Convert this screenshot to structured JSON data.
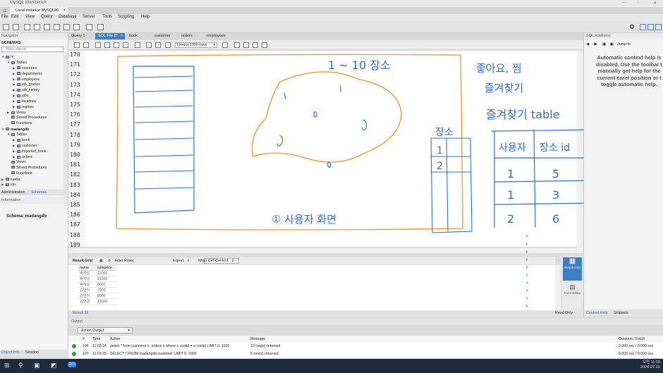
{
  "window": {
    "title": "MySQL Workbench"
  },
  "connection_tab": {
    "label": "Local instance MySQL80"
  },
  "menu": [
    "File",
    "Edit",
    "View",
    "Query",
    "Database",
    "Server",
    "Tools",
    "Scripting",
    "Help"
  ],
  "navigator": {
    "header": "Navigator",
    "schemas_label": "SCHEMAS",
    "filter_placeholder": "Filter objects",
    "tree": [
      {
        "label": "hr",
        "level": 0,
        "arrow": "▼",
        "icon": true
      },
      {
        "label": "Tables",
        "level": 1,
        "arrow": "▼",
        "icon": true
      },
      {
        "label": "countries",
        "level": 2,
        "arrow": "▶",
        "icon": true
      },
      {
        "label": "departments",
        "level": 2,
        "arrow": "▶",
        "icon": true
      },
      {
        "label": "employees",
        "level": 2,
        "arrow": "▶",
        "icon": true
      },
      {
        "label": "job_grades",
        "level": 2,
        "arrow": "▶",
        "icon": true
      },
      {
        "label": "job_history",
        "level": 2,
        "arrow": "▶",
        "icon": true
      },
      {
        "label": "jobs",
        "level": 2,
        "arrow": "▶",
        "icon": true
      },
      {
        "label": "locations",
        "level": 2,
        "arrow": "▶",
        "icon": true
      },
      {
        "label": "regions",
        "level": 2,
        "arrow": "▶",
        "icon": true
      },
      {
        "label": "Views",
        "level": 1,
        "arrow": "▶",
        "icon": true
      },
      {
        "label": "Stored Procedures",
        "level": 1,
        "arrow": "",
        "icon": true
      },
      {
        "label": "Functions",
        "level": 1,
        "arrow": "",
        "icon": true
      },
      {
        "label": "madangdb",
        "level": 0,
        "arrow": "▼",
        "icon": true,
        "bold": true
      },
      {
        "label": "Tables",
        "level": 1,
        "arrow": "▼",
        "icon": true
      },
      {
        "label": "book",
        "level": 2,
        "arrow": "▶",
        "icon": true
      },
      {
        "label": "customer",
        "level": 2,
        "arrow": "▶",
        "icon": true
      },
      {
        "label": "imported_book",
        "level": 2,
        "arrow": "▶",
        "icon": true
      },
      {
        "label": "orders",
        "level": 2,
        "arrow": "▶",
        "icon": true
      },
      {
        "label": "Views",
        "level": 1,
        "arrow": "",
        "icon": true
      },
      {
        "label": "Stored Procedures",
        "level": 1,
        "arrow": "",
        "icon": true
      },
      {
        "label": "Functions",
        "level": 1,
        "arrow": "",
        "icon": true
      },
      {
        "label": "sakila",
        "level": 0,
        "arrow": "▶",
        "icon": true
      },
      {
        "label": "sys",
        "level": 0,
        "arrow": "▶",
        "icon": true
      }
    ],
    "tabs": [
      "Administration",
      "Schemas"
    ],
    "info_header": "Information",
    "schema_info": "Schema: madangdb",
    "bottom_tabs": [
      "Object Info",
      "Session"
    ]
  },
  "query_tabs": [
    "Query 1",
    "SQL File 8*",
    "book",
    "customer",
    "orders",
    "employees"
  ],
  "editor": {
    "limit_label": "Limit to 1000 rows",
    "line_numbers": [
      "170",
      "171",
      "172",
      "173",
      "174",
      "175",
      "176",
      "177",
      "178",
      "179",
      "180",
      "181",
      "182",
      "183",
      "184",
      "185",
      "186",
      "187",
      "188",
      "189"
    ]
  },
  "result_grid": {
    "toolbar": {
      "result_grid": "Result Grid",
      "filter_rows": "Filter Rows:",
      "export": "Export:",
      "wrap": "Wrap Cell Content:"
    },
    "columns": [
      "name",
      "saleprice"
    ],
    "rows": [
      [
        "박지성",
        "12000"
      ],
      [
        "박지성",
        "21000"
      ],
      [
        "박지성",
        "6000"
      ],
      [
        "김연아",
        "7000"
      ],
      [
        "김연아",
        "8000"
      ],
      [
        "김연경",
        "13000"
      ]
    ],
    "side_buttons": [
      "Result Grid",
      "Form Editor"
    ],
    "result_tab": "Result 39",
    "read_only": "Read Only"
  },
  "sql_additions": {
    "header": "SQL Additions",
    "jump_to": "Jump to",
    "help_lines": [
      "Automatic context help is",
      "disabled. Use the toolbar t",
      "manually get help for the",
      "current caret position or t",
      "toggle automatic help."
    ],
    "tabs": [
      "Context Help",
      "Snippets"
    ]
  },
  "output": {
    "header": "Output",
    "selector": "Action Output",
    "columns": [
      "#",
      "Time",
      "Action",
      "Message",
      "Duration / Fetch"
    ],
    "rows": [
      {
        "num": "106",
        "time": "11:03:14",
        "action": "select * from customer c, orders o  where c.custid = o.custid LIMIT 0, 1000",
        "message": "10 row(s) returned",
        "duration": "0.000 sec / 0.000 sec"
      },
      {
        "num": "107",
        "time": "11:03:25",
        "action": "SELECT * FROM madangdb.customer LIMIT 0, 1000",
        "message": "5 row(s) returned",
        "duration": "0.000 sec / 0.000 sec"
      }
    ]
  },
  "handwriting": {
    "range_note": "1 ~ 10  장소",
    "user_screen": "① 사용자 화면",
    "places_header": "장소",
    "places_rows": [
      "1",
      "2"
    ],
    "like_note": "좋아요, 찜",
    "bookmark_note": "즐겨찾기",
    "fav_table_title": "즐겨찾기 table",
    "fav_table_cols": [
      "사용자",
      "장소 id"
    ],
    "fav_table_rows": [
      [
        "1",
        "5"
      ],
      [
        "1",
        "3"
      ],
      [
        "2",
        "6"
      ]
    ]
  },
  "taskbar": {
    "clock_time": "오전 11:18",
    "clock_date": "2024-07-10"
  },
  "colors": {
    "accent": "#3d7fc4",
    "ink_blue": "#2e6fd8",
    "ink_orange": "#f0962c",
    "ink_green": "#3aa83a",
    "ok_green": "#2f9b3a"
  }
}
